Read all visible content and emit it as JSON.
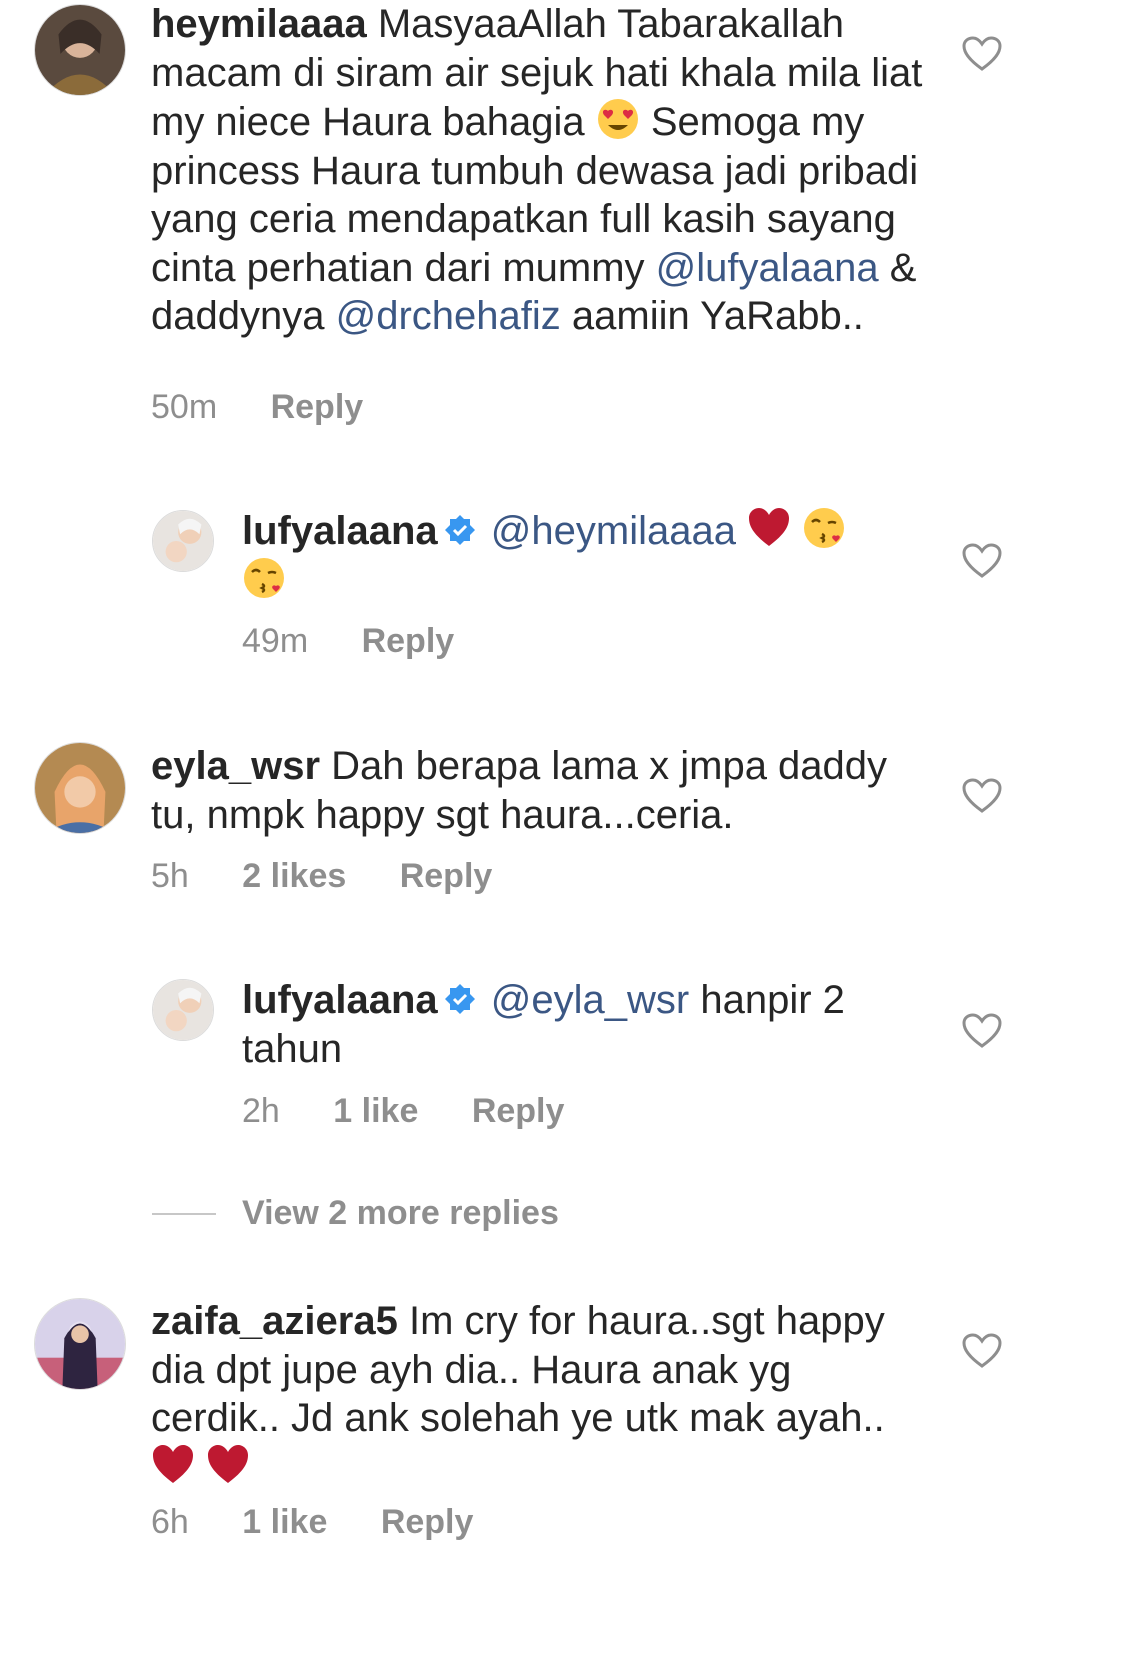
{
  "comments": [
    {
      "username": "heymilaaaa",
      "parts": [
        "MasyaaAllah Tabarakallah macam di siram air sejuk hati khala mila liat my niece Haura bahagia",
        "Semoga my princess Haura tumbuh dewasa jadi pribadi yang ceria mendapatkan full kasih sayang cinta perhatian  dari mummy",
        "@lufyalaana",
        "& daddynya",
        "@drchehafiz",
        "aamiin YaRabb.."
      ],
      "time": "50m",
      "reply": "Reply"
    },
    {
      "username": "lufyalaana",
      "mention": "@heymilaaaa",
      "time": "49m",
      "reply": "Reply"
    },
    {
      "username": "eyla_wsr",
      "body": "Dah berapa lama x jmpa daddy tu, nmpk happy sgt haura...ceria.",
      "time": "5h",
      "likes": "2 likes",
      "reply": "Reply"
    },
    {
      "username": "lufyalaana",
      "mention": "@eyla_wsr",
      "body": "hanpir 2 tahun",
      "time": "2h",
      "likes": "1 like",
      "reply": "Reply"
    },
    {
      "username": "zaifa_aziera5",
      "body": "Im cry for haura..sgt happy dia dpt jupe ayh dia.. Haura anak yg cerdik.. Jd ank solehah ye utk mak ayah..",
      "time": "6h",
      "likes": "1 like",
      "reply": "Reply"
    }
  ],
  "view_more": "View 2 more replies",
  "colors": {
    "mention": "#3b5784",
    "meta": "#8e8e8e",
    "text": "#262626",
    "verified": "#3897f0",
    "heart_red": "#e0245e"
  }
}
